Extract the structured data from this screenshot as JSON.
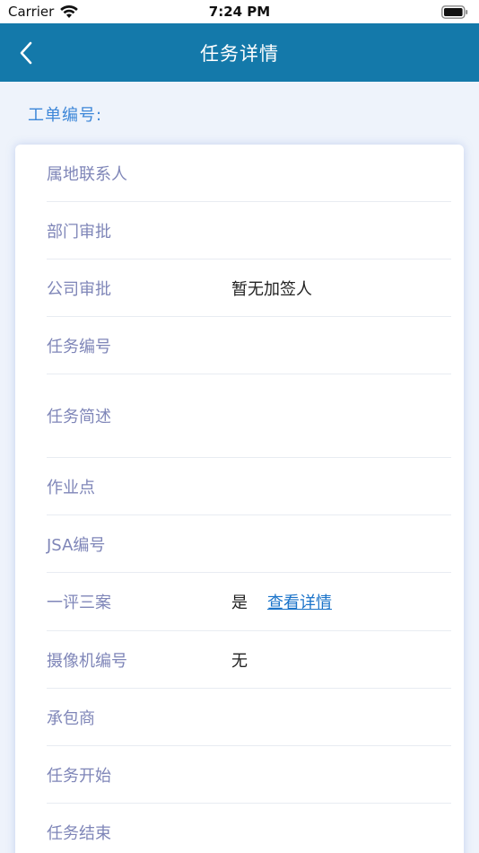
{
  "status_bar": {
    "carrier": "Carrier",
    "time": "7:24 PM"
  },
  "nav": {
    "title": "任务详情"
  },
  "order": {
    "label": "工单编号:"
  },
  "rows": [
    {
      "label": "属地联系人",
      "value": ""
    },
    {
      "label": "部门审批",
      "value": ""
    },
    {
      "label": "公司审批",
      "value": "暂无加签人"
    },
    {
      "label": "任务编号",
      "value": ""
    },
    {
      "label": "任务简述",
      "value": ""
    },
    {
      "label": "作业点",
      "value": ""
    },
    {
      "label": "JSA编号",
      "value": ""
    },
    {
      "label": "一评三案",
      "value": "是",
      "link": "查看详情"
    },
    {
      "label": "摄像机编号",
      "value": "无"
    },
    {
      "label": "承包商",
      "value": ""
    },
    {
      "label": "任务开始",
      "value": ""
    },
    {
      "label": "任务结束",
      "value": ""
    }
  ],
  "colors": {
    "nav_background": "#1479aa",
    "label_text": "#7f86b8",
    "link": "#1a73c9",
    "order_label": "#3c86d8"
  }
}
